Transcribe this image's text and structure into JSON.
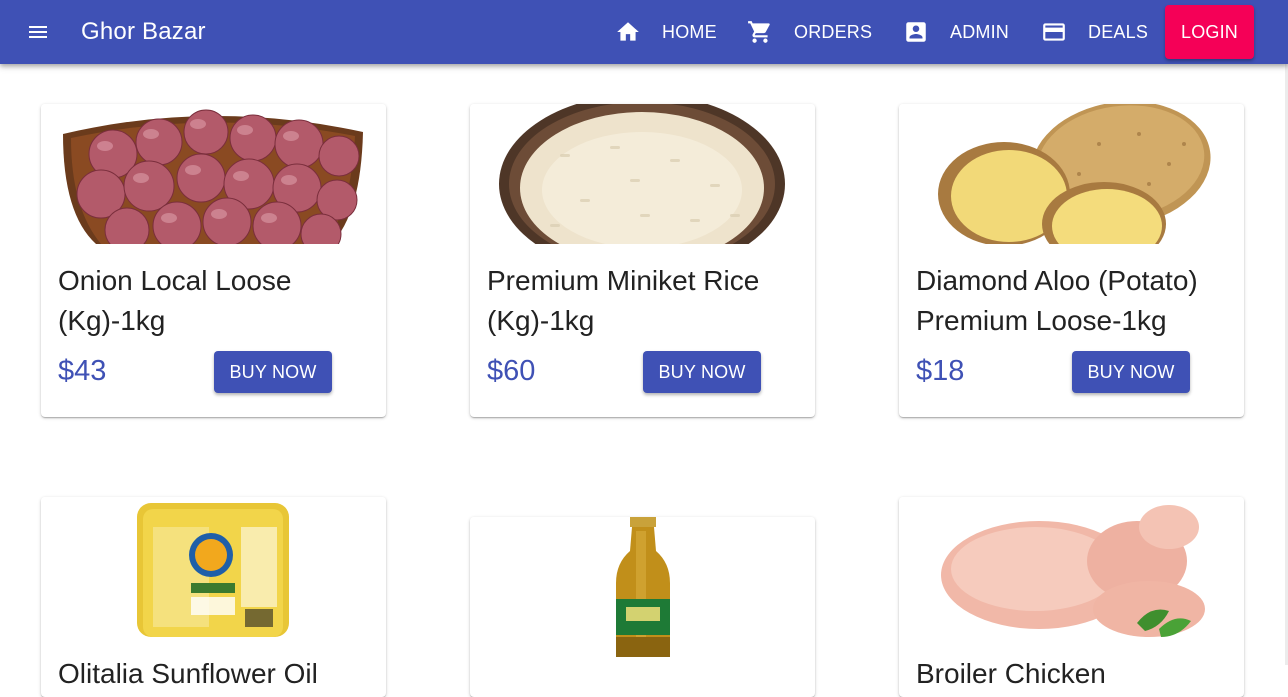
{
  "app": {
    "title": "Ghor Bazar"
  },
  "nav": [
    {
      "label": "HOME",
      "icon": "home-icon"
    },
    {
      "label": "ORDERS",
      "icon": "cart-icon"
    },
    {
      "label": "ADMIN",
      "icon": "account-box-icon"
    },
    {
      "label": "DEALS",
      "icon": "credit-card-icon"
    }
  ],
  "login_label": "LOGIN",
  "colors": {
    "primary": "#3f51b5",
    "accent": "#f50057"
  },
  "products": [
    {
      "name": "Onion Local Loose (Kg)-1kg",
      "price": "$43",
      "buy_label": "BUY NOW"
    },
    {
      "name": "Premium Miniket Rice (Kg)-1kg",
      "price": "$60",
      "buy_label": "BUY NOW"
    },
    {
      "name": "Diamond Aloo (Potato) Premium Loose-1kg",
      "price": "$18",
      "buy_label": "BUY NOW"
    },
    {
      "name": "Olitalia Sunflower Oil",
      "price": "",
      "buy_label": ""
    },
    {
      "name": "",
      "price": "",
      "buy_label": ""
    },
    {
      "name": "Broiler Chicken",
      "price": "",
      "buy_label": ""
    }
  ]
}
